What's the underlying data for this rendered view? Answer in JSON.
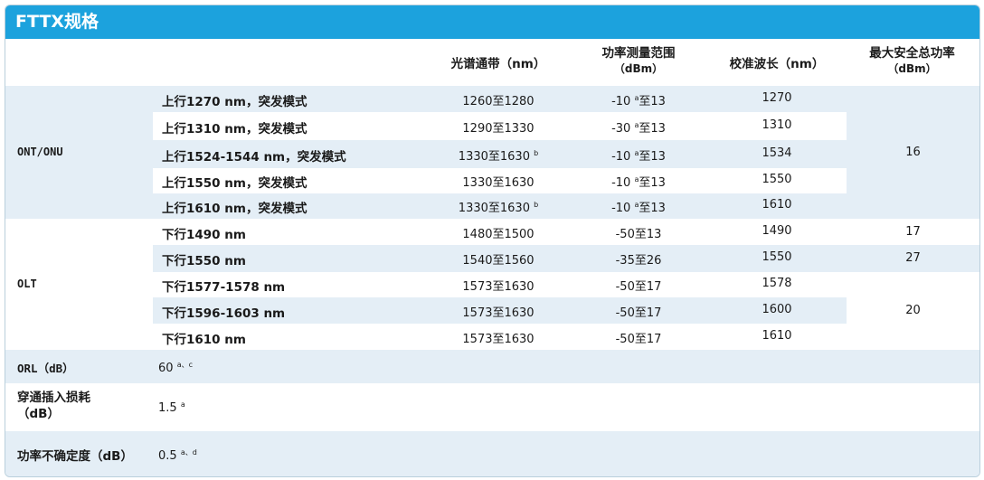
{
  "title": "FTTX规格",
  "headers": {
    "passband": "光谱通带（nm）",
    "power_range_l1": "功率测量范围",
    "power_range_l2": "（dBm）",
    "cal_wavelength": "校准波长（nm）",
    "max_power_l1": "最大安全总功率",
    "max_power_l2": "（dBm）"
  },
  "groups": {
    "ont": "ONT/ONU",
    "olt": "OLT",
    "ont_max_power": "16",
    "olt_max_power_1": "17",
    "olt_max_power_2": "27",
    "olt_max_power_3": "20"
  },
  "rows": [
    {
      "label": "上行1270 nm，突发模式",
      "passband": "1260至1280",
      "passband_sup": "",
      "power_a": "-10 ",
      "power_sup": "a",
      "power_b": "至13",
      "cal": "1270"
    },
    {
      "label": "上行1310 nm，突发模式",
      "passband": "1290至1330",
      "passband_sup": "",
      "power_a": "-30 ",
      "power_sup": "a",
      "power_b": "至13",
      "cal": "1310"
    },
    {
      "label": "上行1524-1544 nm，突发模式",
      "passband": "1330至1630 ",
      "passband_sup": "b",
      "power_a": "-10 ",
      "power_sup": "a",
      "power_b": "至13",
      "cal": "1534"
    },
    {
      "label": "上行1550 nm，突发模式",
      "passband": "1330至1630",
      "passband_sup": "",
      "power_a": "-10 ",
      "power_sup": "a",
      "power_b": "至13",
      "cal": "1550"
    },
    {
      "label": "上行1610 nm，突发模式",
      "passband": "1330至1630 ",
      "passband_sup": "b",
      "power_a": "-10 ",
      "power_sup": "a",
      "power_b": "至13",
      "cal": "1610"
    },
    {
      "label": "下行1490 nm",
      "passband": "1480至1500",
      "passband_sup": "",
      "power_a": "-50至13",
      "power_sup": "",
      "power_b": "",
      "cal": "1490"
    },
    {
      "label": "下行1550 nm",
      "passband": "1540至1560",
      "passband_sup": "",
      "power_a": "-35至26",
      "power_sup": "",
      "power_b": "",
      "cal": "1550"
    },
    {
      "label": "下行1577-1578 nm",
      "passband": "1573至1630",
      "passband_sup": "",
      "power_a": "-50至17",
      "power_sup": "",
      "power_b": "",
      "cal": "1578"
    },
    {
      "label": "下行1596-1603 nm",
      "passband": "1573至1630",
      "passband_sup": "",
      "power_a": "-50至17",
      "power_sup": "",
      "power_b": "",
      "cal": "1600"
    },
    {
      "label": "下行1610 nm",
      "passband": "1573至1630",
      "passband_sup": "",
      "power_a": "-50至17",
      "power_sup": "",
      "power_b": "",
      "cal": "1610"
    }
  ],
  "orl": {
    "label": "ORL（dB）",
    "value": "60 ",
    "sup": "a、c"
  },
  "insertion": {
    "label_l1": "穿通插入损耗",
    "label_l2": "（dB）",
    "value": "1.5 ",
    "sup": "a"
  },
  "uncertainty": {
    "label": "功率不确定度（dB）",
    "value": "0.5 ",
    "sup": "a、d"
  },
  "colors": {
    "title_bg": "#1ca2dd",
    "band_blue": "#e4eef6",
    "text": "#1a1a1a"
  }
}
